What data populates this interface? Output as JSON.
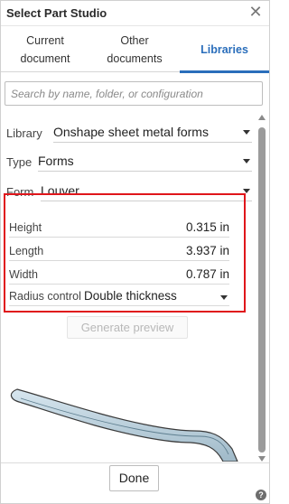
{
  "dialog": {
    "title": "Select Part Studio",
    "close_icon": "close-icon"
  },
  "tabs": [
    {
      "label": "Current document"
    },
    {
      "label": "Other documents"
    },
    {
      "label": "Libraries",
      "active": true
    }
  ],
  "search": {
    "placeholder": "Search by name, folder, or configuration",
    "value": ""
  },
  "fields": {
    "library": {
      "label": "Library",
      "value": "Onshape sheet metal forms"
    },
    "type": {
      "label": "Type",
      "value": "Forms"
    },
    "form": {
      "label": "Form",
      "value": "Louver"
    }
  },
  "parameters": {
    "height": {
      "label": "Height",
      "value": "0.315 in"
    },
    "length": {
      "label": "Length",
      "value": "3.937 in"
    },
    "width": {
      "label": "Width",
      "value": "0.787 in"
    },
    "radius_control": {
      "label": "Radius control",
      "value": "Double thickness"
    }
  },
  "generate_preview": {
    "label": "Generate preview",
    "enabled": false
  },
  "footer": {
    "done_label": "Done",
    "help_glyph": "?"
  },
  "colors": {
    "accent": "#2a6ebb",
    "highlight_box": "#e0161b",
    "preview_fill": "#b8cfdc"
  }
}
